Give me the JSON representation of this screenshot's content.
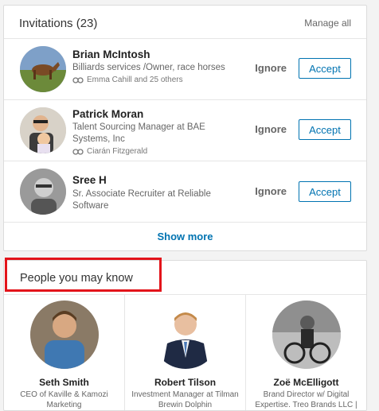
{
  "invitations": {
    "title": "Invitations (23)",
    "manage_all": "Manage all",
    "ignore_label": "Ignore",
    "accept_label": "Accept",
    "show_more": "Show more",
    "items": [
      {
        "name": "Brian McIntosh",
        "headline": "Billiards services /Owner, race horses",
        "connections": "Emma Cahill and 25 others"
      },
      {
        "name": "Patrick Moran",
        "headline": "Talent Sourcing Manager at BAE Systems, Inc",
        "connections": "Ciarán Fitzgerald"
      },
      {
        "name": "Sree H",
        "headline": "Sr. Associate Recruiter at Reliable Software",
        "connections": ""
      }
    ]
  },
  "pymk": {
    "title": "People you may know",
    "people": [
      {
        "name": "Seth Smith",
        "headline": "CEO of Kaville & Kamozi Marketing"
      },
      {
        "name": "Robert Tilson",
        "headline": "Investment Manager at Tilman Brewin Dolphin"
      },
      {
        "name": "Zoë McElligott",
        "headline": "Brand Director w/ Digital Expertise. Treo Brands LLC |"
      }
    ]
  },
  "colors": {
    "accent": "#0073b1",
    "highlight": "#e3141b"
  }
}
